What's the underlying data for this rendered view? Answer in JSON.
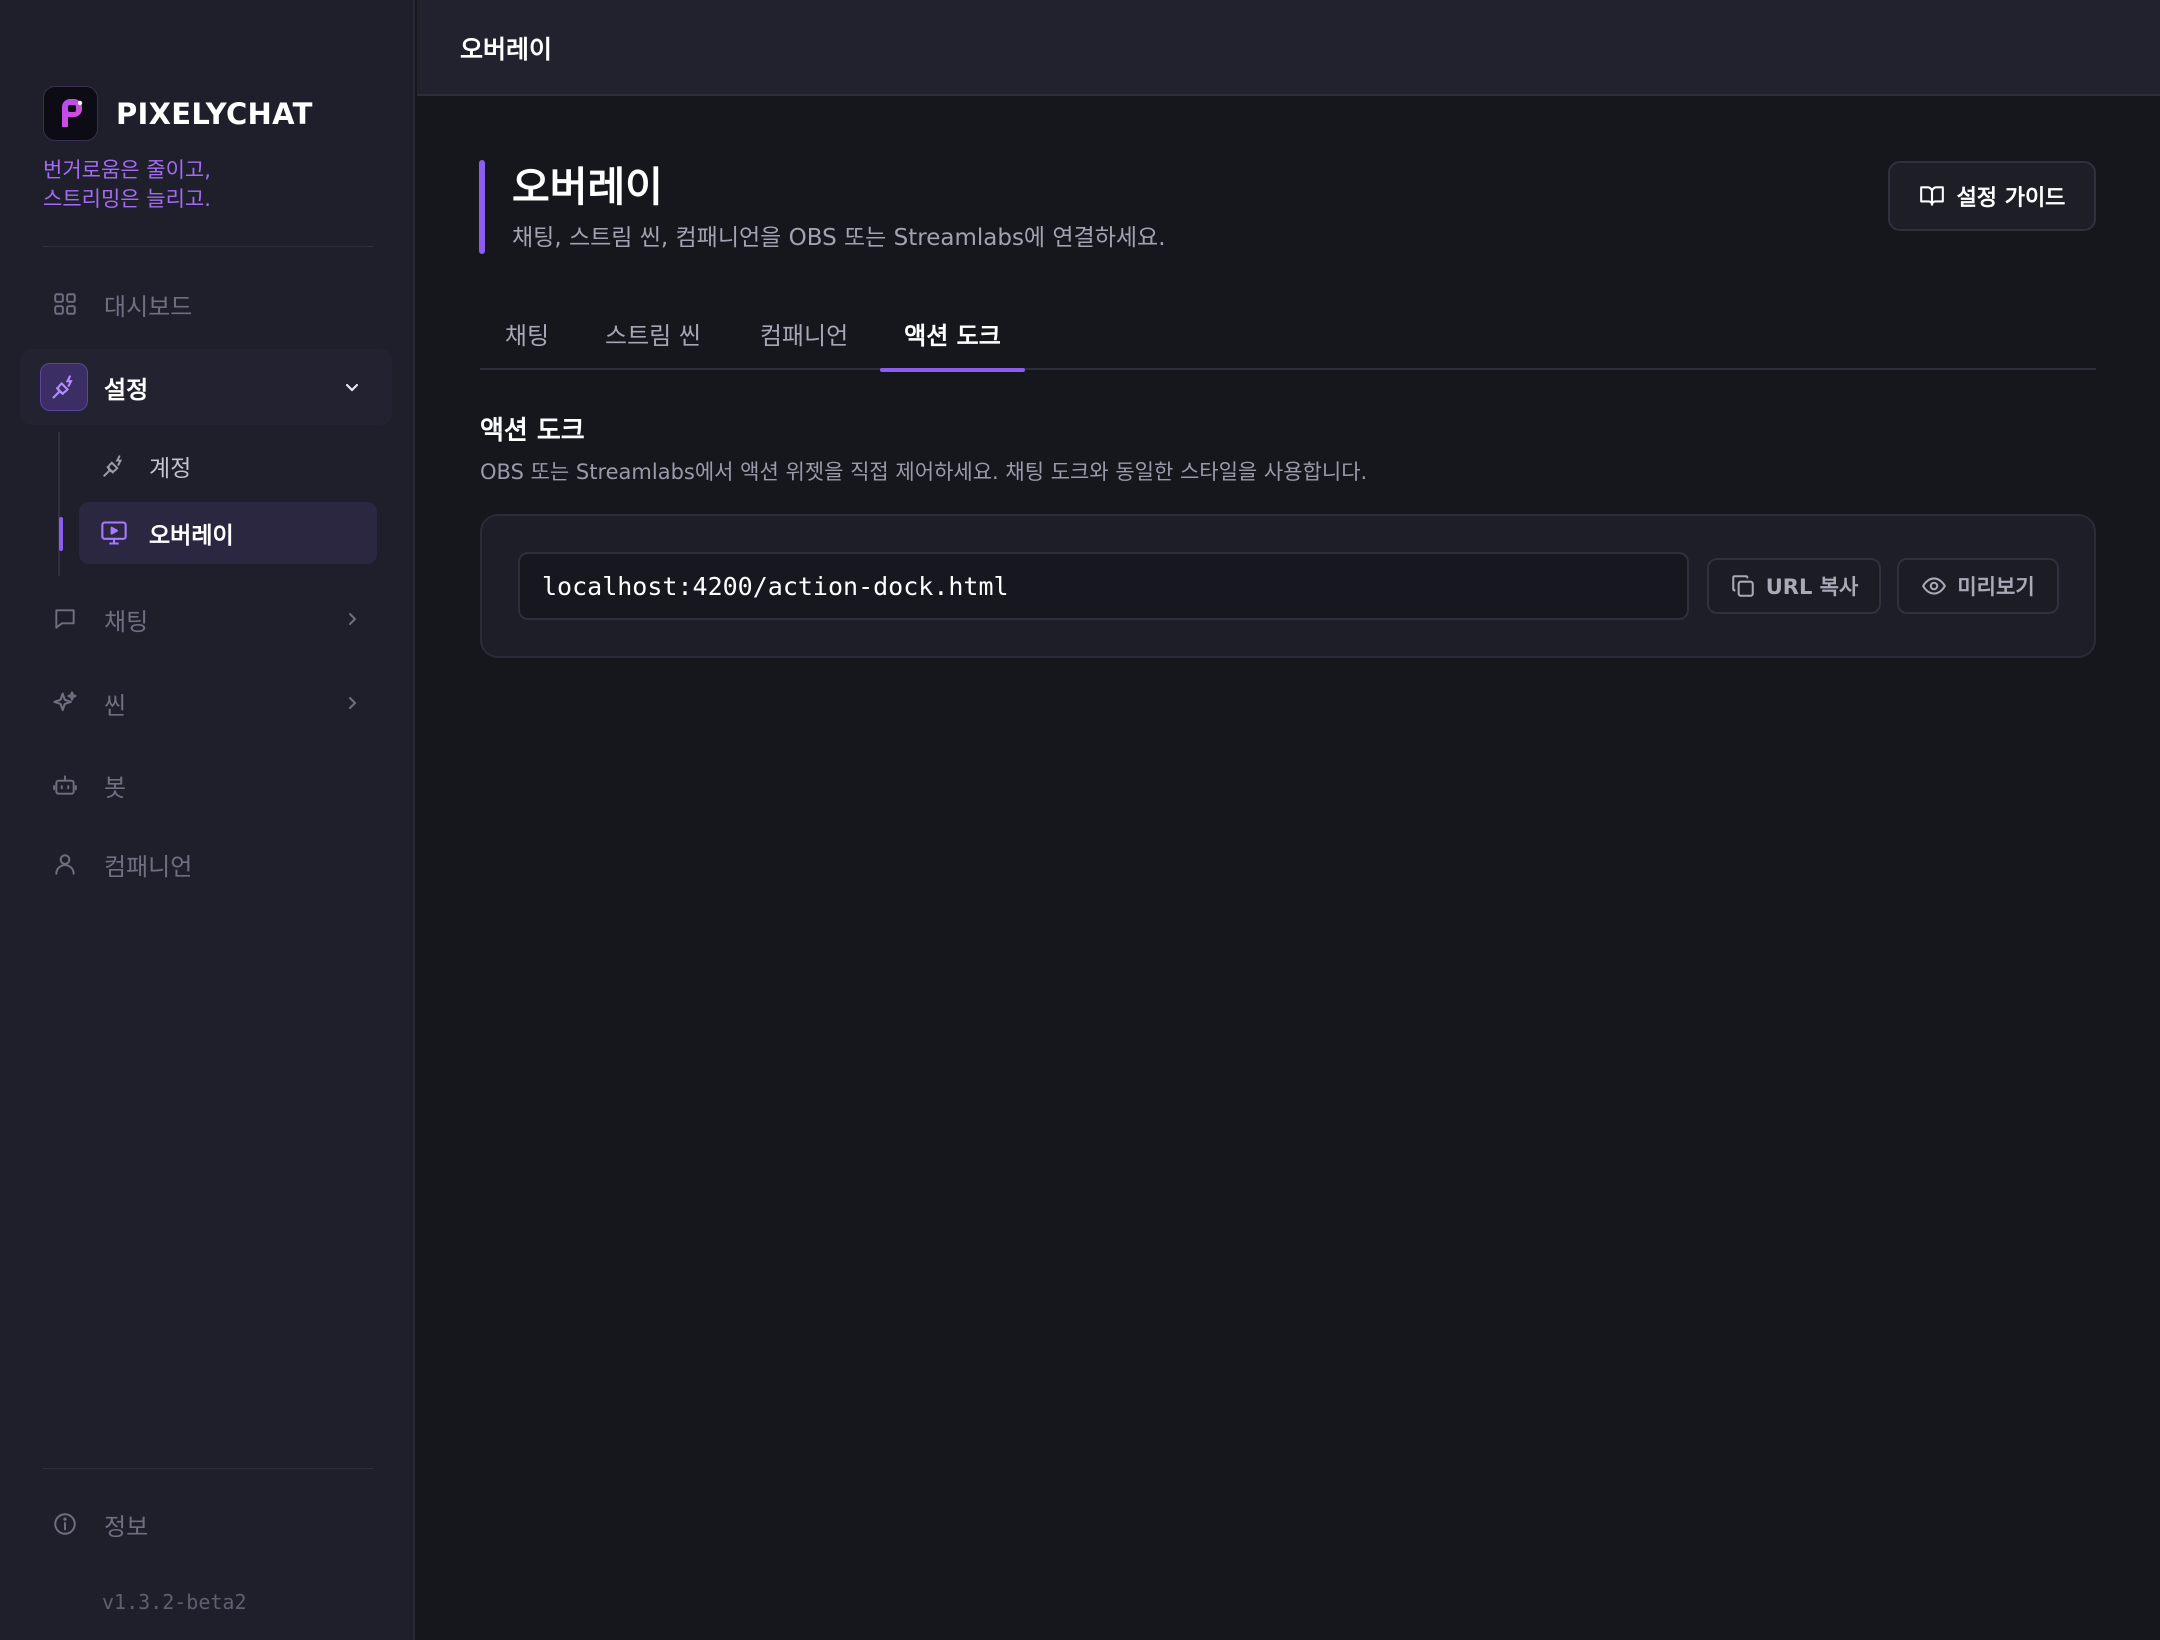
{
  "brand": {
    "name": "PIXELYCHAT",
    "tagline_line1": "번거로움은 줄이고,",
    "tagline_line2": "스트리밍은 늘리고."
  },
  "sidebar": {
    "items": [
      {
        "label": "대시보드",
        "icon": "grid-icon"
      },
      {
        "label": "설정",
        "icon": "plug-icon"
      },
      {
        "label": "채팅",
        "icon": "chat-icon"
      },
      {
        "label": "씬",
        "icon": "sparkles-icon"
      },
      {
        "label": "봇",
        "icon": "bot-icon"
      },
      {
        "label": "컴패니언",
        "icon": "user-icon"
      }
    ],
    "settings_sub": [
      {
        "label": "계정",
        "icon": "plug-icon"
      },
      {
        "label": "오버레이",
        "icon": "monitor-play-icon"
      }
    ],
    "info_label": "정보",
    "version": "v1.3.2-beta2"
  },
  "topbar": {
    "title": "오버레이"
  },
  "header": {
    "title": "오버레이",
    "subtitle": "채팅, 스트림 씬, 컴패니언을 OBS 또는 Streamlabs에 연결하세요.",
    "guide_button": "설정 가이드"
  },
  "tabs": [
    {
      "label": "채팅"
    },
    {
      "label": "스트림 씬"
    },
    {
      "label": "컴패니언"
    },
    {
      "label": "액션 도크",
      "active": true
    }
  ],
  "section": {
    "title": "액션 도크",
    "description": "OBS 또는 Streamlabs에서 액션 위젯을 직접 제어하세요. 채팅 도크와 동일한 스타일을 사용합니다.",
    "url": "localhost:4200/action-dock.html",
    "copy_button": "URL 복사",
    "preview_button": "미리보기"
  },
  "colors": {
    "accent": "#8e5cf0",
    "background": "#16171d",
    "sidebar": "#1f1f2b"
  }
}
